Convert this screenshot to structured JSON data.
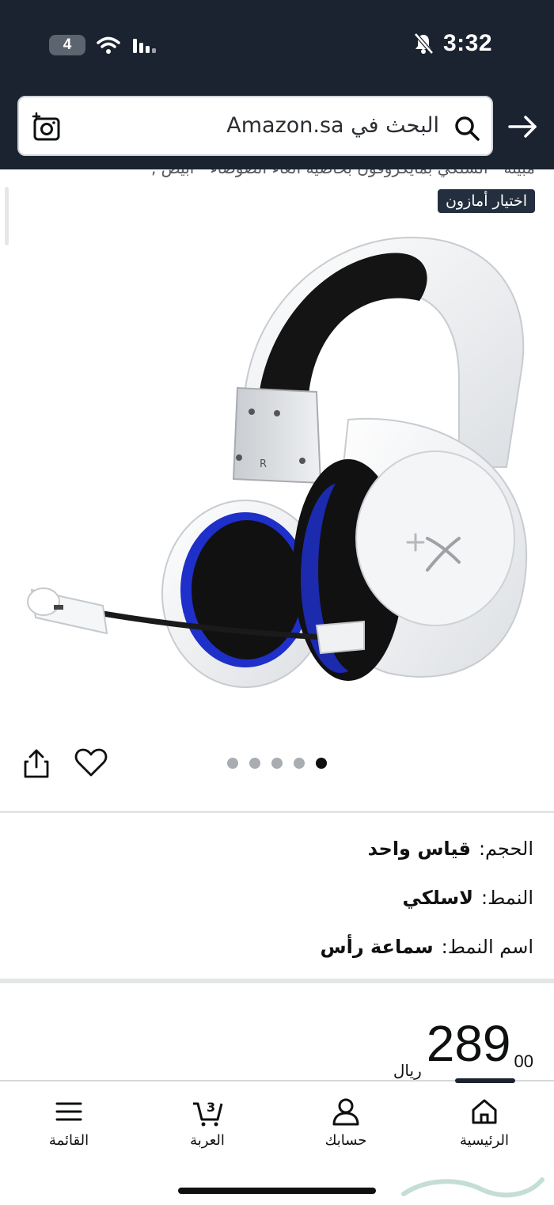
{
  "status_bar": {
    "battery_level": "4",
    "time": "3:32"
  },
  "search": {
    "placeholder": "البحث في Amazon.sa"
  },
  "product": {
    "title_fragment": "مبينة - السلكي بمايكروفون بخاصية الغاء الضوضاء - ابيض ,",
    "badge": "اختيار أمازون",
    "image_count": 5,
    "active_image_index": 4
  },
  "variations": {
    "size": {
      "label": "الحجم:",
      "value": "قياس واحد"
    },
    "style": {
      "label": "النمط:",
      "value": "لاسلكي"
    },
    "style_name": {
      "label": "اسم النمط:",
      "value": "سماعة رأس"
    }
  },
  "price": {
    "whole": "289",
    "fraction": "00",
    "currency": "ريال"
  },
  "bottom_nav": {
    "items": [
      {
        "label": "الرئيسية",
        "icon": "home-icon"
      },
      {
        "label": "حسابك",
        "icon": "account-icon"
      },
      {
        "label": "العربة",
        "icon": "cart-icon",
        "count": "3"
      },
      {
        "label": "القائمة",
        "icon": "menu-icon"
      }
    ]
  },
  "colors": {
    "header_bg": "#1b2330",
    "badge_bg": "#232f3e",
    "accent_blue": "#1f2fc9"
  }
}
